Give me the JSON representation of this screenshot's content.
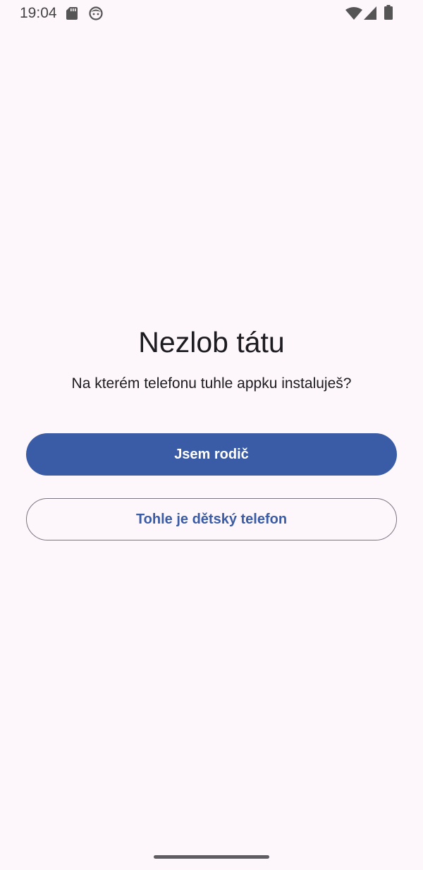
{
  "status_bar": {
    "time": "19:04",
    "left_icons": [
      "sd-card-icon",
      "face-icon"
    ],
    "right_icons": [
      "wifi-icon",
      "cell-signal-icon",
      "battery-icon"
    ]
  },
  "main": {
    "title": "Nezlob tátu",
    "subtitle": "Na kterém telefonu tuhle appku instaluješ?",
    "primary_button_label": "Jsem rodič",
    "secondary_button_label": "Tohle je dětský telefon"
  },
  "colors": {
    "background": "#fdf6fb",
    "primary": "#3a5ba5",
    "text": "#1c1b1f",
    "outline": "#7a7680"
  }
}
